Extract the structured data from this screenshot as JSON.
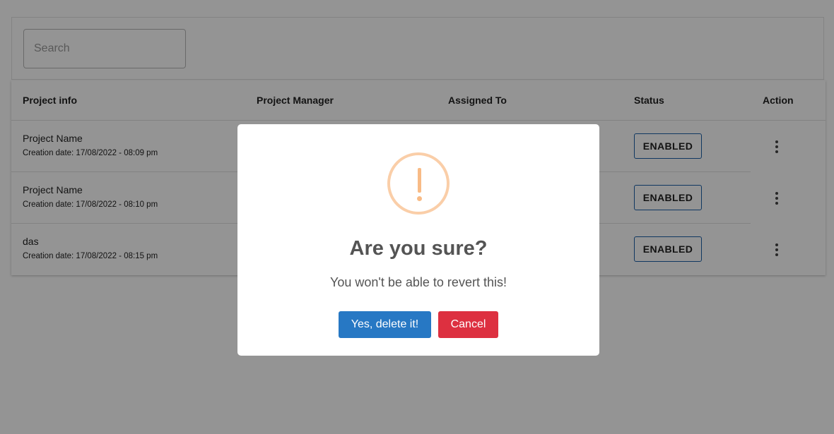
{
  "search": {
    "placeholder": "Search",
    "value": ""
  },
  "table": {
    "headers": {
      "project_info": "Project info",
      "project_manager": "Project Manager",
      "assigned_to": "Assigned To",
      "status": "Status",
      "action": "Action"
    },
    "rows": [
      {
        "name": "Project Name",
        "creation": "Creation date: 17/08/2022 - 08:09 pm",
        "status": "ENABLED"
      },
      {
        "name": "Project Name",
        "creation": "Creation date: 17/08/2022 - 08:10 pm",
        "status": "ENABLED"
      },
      {
        "name": "das",
        "creation": "Creation date: 17/08/2022 - 08:15 pm",
        "status": "ENABLED"
      }
    ]
  },
  "dialog": {
    "icon": "warning-exclamation-icon",
    "title": "Are you sure?",
    "text": "You won't be able to revert this!",
    "confirm_label": "Yes, delete it!",
    "cancel_label": "Cancel"
  },
  "colors": {
    "confirm": "#2778c4",
    "cancel": "#dd3040",
    "warning": "#f8bb86",
    "status_border": "#1a5fa8"
  }
}
